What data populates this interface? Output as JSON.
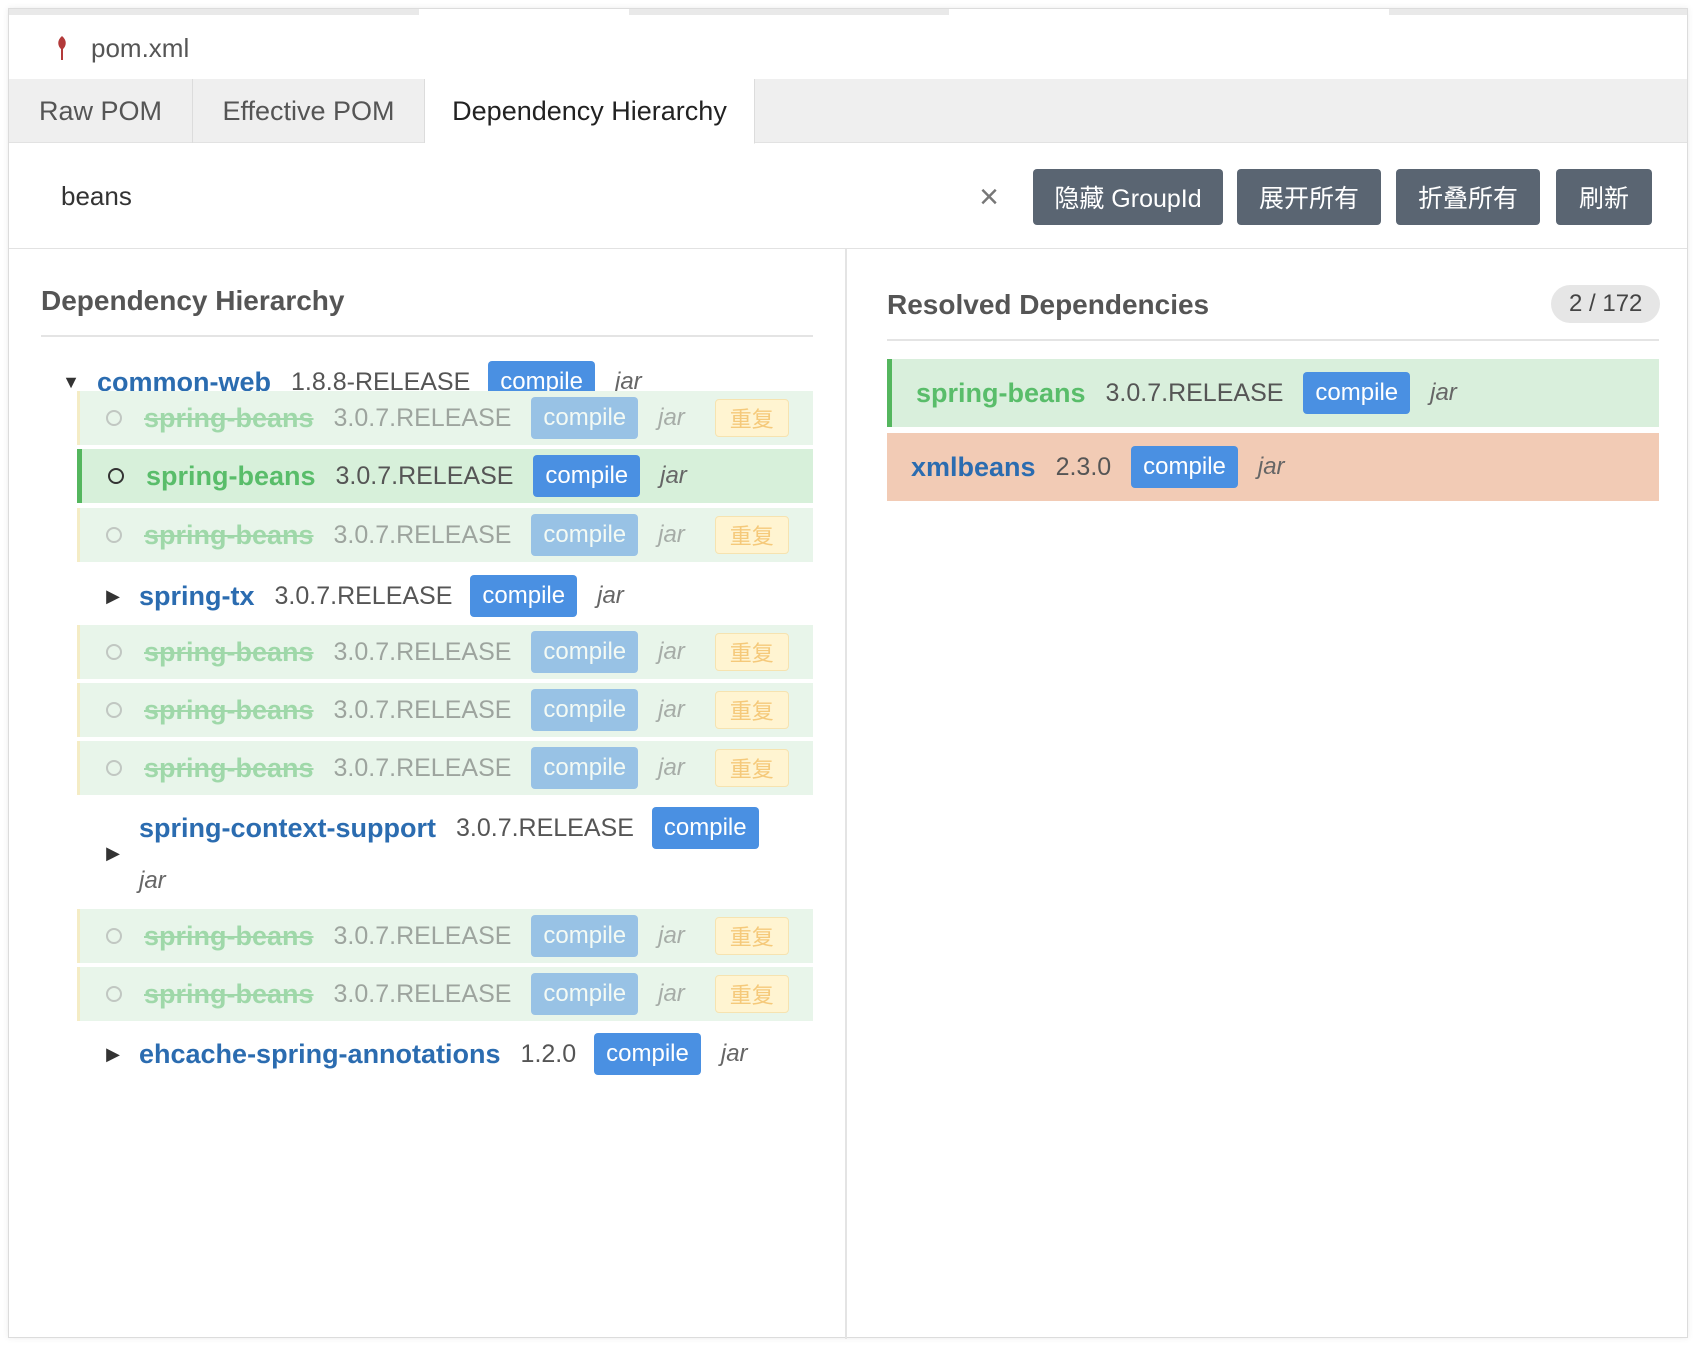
{
  "file": {
    "name": "pom.xml"
  },
  "tabs": [
    {
      "label": "Raw POM"
    },
    {
      "label": "Effective POM"
    },
    {
      "label": "Dependency Hierarchy"
    }
  ],
  "toolbar": {
    "search_value": "beans",
    "clear_glyph": "×",
    "buttons": {
      "hide_groupid": "隐藏 GroupId",
      "expand_all": "展开所有",
      "collapse_all": "折叠所有",
      "refresh": "刷新"
    }
  },
  "hierarchy": {
    "title": "Dependency Hierarchy",
    "root": {
      "toggle": "▼",
      "name": "common-web",
      "version": "1.8.8-RELEASE",
      "scope": "compile",
      "type": "jar"
    },
    "items": [
      {
        "kind": "leaf",
        "state": "duplicate",
        "name": "spring-beans",
        "version": "3.0.7.RELEASE",
        "scope": "compile",
        "type": "jar",
        "tag": "重复"
      },
      {
        "kind": "leaf",
        "state": "selected",
        "name": "spring-beans",
        "version": "3.0.7.RELEASE",
        "scope": "compile",
        "type": "jar"
      },
      {
        "kind": "leaf",
        "state": "duplicate",
        "name": "spring-beans",
        "version": "3.0.7.RELEASE",
        "scope": "compile",
        "type": "jar",
        "tag": "重复"
      },
      {
        "kind": "node",
        "toggle": "▶",
        "name": "spring-tx",
        "version": "3.0.7.RELEASE",
        "scope": "compile",
        "type": "jar"
      },
      {
        "kind": "leaf",
        "state": "duplicate",
        "name": "spring-beans",
        "version": "3.0.7.RELEASE",
        "scope": "compile",
        "type": "jar",
        "tag": "重复"
      },
      {
        "kind": "leaf",
        "state": "duplicate",
        "name": "spring-beans",
        "version": "3.0.7.RELEASE",
        "scope": "compile",
        "type": "jar",
        "tag": "重复"
      },
      {
        "kind": "leaf",
        "state": "duplicate",
        "name": "spring-beans",
        "version": "3.0.7.RELEASE",
        "scope": "compile",
        "type": "jar",
        "tag": "重复"
      },
      {
        "kind": "node",
        "toggle": "▶",
        "name": "spring-context-support",
        "version": "3.0.7.RELEASE",
        "scope": "compile",
        "type": "jar"
      },
      {
        "kind": "leaf",
        "state": "duplicate",
        "name": "spring-beans",
        "version": "3.0.7.RELEASE",
        "scope": "compile",
        "type": "jar",
        "tag": "重复"
      },
      {
        "kind": "leaf",
        "state": "duplicate",
        "name": "spring-beans",
        "version": "3.0.7.RELEASE",
        "scope": "compile",
        "type": "jar",
        "tag": "重复"
      },
      {
        "kind": "node",
        "toggle": "▶",
        "name": "ehcache-spring-annotations",
        "version": "1.2.0",
        "scope": "compile",
        "type": "jar"
      }
    ]
  },
  "resolved": {
    "title": "Resolved Dependencies",
    "count": "2 / 172",
    "items": [
      {
        "name": "spring-beans",
        "version": "3.0.7.RELEASE",
        "scope": "compile",
        "type": "jar"
      },
      {
        "name": "xmlbeans",
        "version": "2.3.0",
        "scope": "compile",
        "type": "jar"
      }
    ]
  },
  "colors": {
    "scope_badge": "#4a90e2",
    "link_blue": "#2b6cb0",
    "match_green": "#59bd6a",
    "row_highlight": "#e8f5ea",
    "conflict_row": "#f2cbb5",
    "button_bg": "#5a6572"
  },
  "icons": {
    "file": "maven-feather-icon",
    "clear": "close-icon",
    "expanded": "caret-down-icon",
    "collapsed": "caret-right-icon",
    "leaf": "circle-icon"
  }
}
